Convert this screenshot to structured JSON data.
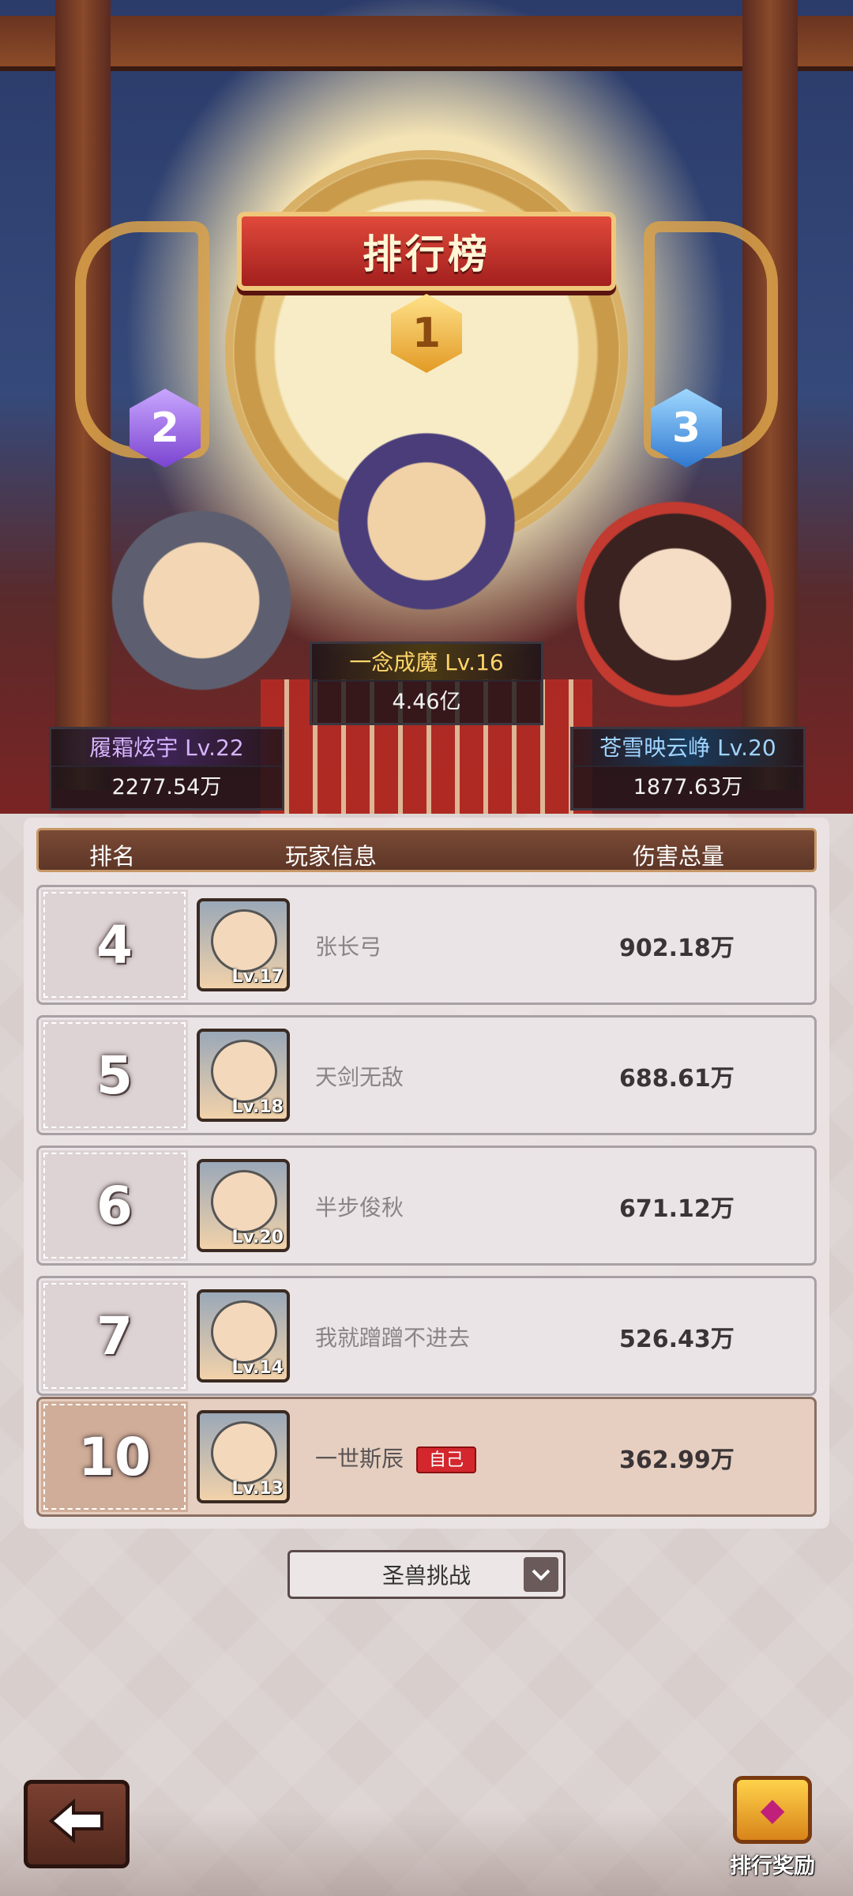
{
  "title": "排行榜",
  "podium": [
    {
      "rank": "1",
      "name_level": "一念成魔 Lv.16",
      "score": "4.46亿"
    },
    {
      "rank": "2",
      "name_level": "履霜炫宇 Lv.22",
      "score": "2277.54万"
    },
    {
      "rank": "3",
      "name_level": "苍雪映云峥 Lv.20",
      "score": "1877.63万"
    }
  ],
  "table": {
    "headers": {
      "rank": "排名",
      "player": "玩家信息",
      "damage": "伤害总量"
    },
    "rows": [
      {
        "rank": "4",
        "level": "Lv.17",
        "name": "张长弓",
        "damage": "902.18万"
      },
      {
        "rank": "5",
        "level": "Lv.18",
        "name": "天剑无敌",
        "damage": "688.61万"
      },
      {
        "rank": "6",
        "level": "Lv.20",
        "name": "半步俊秋",
        "damage": "671.12万"
      },
      {
        "rank": "7",
        "level": "Lv.14",
        "name": "我就蹭蹭不进去",
        "damage": "526.43万"
      }
    ],
    "self_row": {
      "rank": "10",
      "level": "Lv.13",
      "name": "一世斯辰",
      "tag": "自己",
      "damage": "362.99万"
    }
  },
  "dropdown": {
    "selected": "圣兽挑战",
    "icon": "chevron-down-icon"
  },
  "footer": {
    "back_icon": "arrow-left-icon",
    "reward_label": "排行奖励",
    "reward_icon": "treasure-chest-icon"
  }
}
